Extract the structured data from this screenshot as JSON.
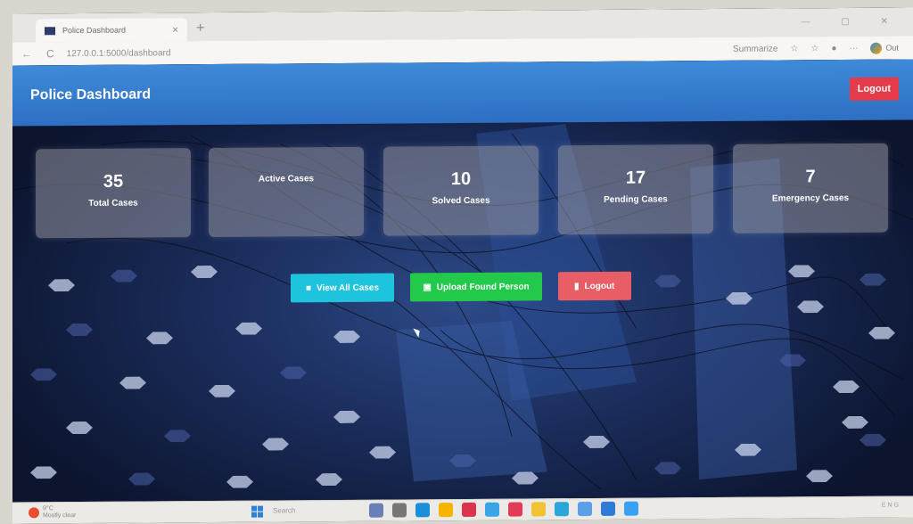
{
  "browser": {
    "tab_title": "Police Dashboard",
    "tab_close": "×",
    "new_tab": "+",
    "window_controls": "—  ▢  ✕",
    "url": "127.0.0.1:5000/dashboard",
    "nav_back": "←",
    "nav_reload": "C",
    "summarize_label": "Summarize",
    "copilot_label": "Out"
  },
  "app": {
    "title": "Police Dashboard",
    "header_logout": "Logout"
  },
  "stats": [
    {
      "value": "35",
      "label": "Total Cases"
    },
    {
      "value": "",
      "label": "Active Cases"
    },
    {
      "value": "10",
      "label": "Solved Cases"
    },
    {
      "value": "17",
      "label": "Pending Cases"
    },
    {
      "value": "7",
      "label": "Emergency Cases"
    }
  ],
  "actions": {
    "view_all": "View All Cases",
    "upload": "Upload Found Person",
    "logout": "Logout"
  },
  "taskbar": {
    "weather_temp": "9°C",
    "weather_text": "Mostly clear",
    "search_placeholder": "Search",
    "tray": "ENG"
  },
  "colors": {
    "header": "#3f8ad9",
    "logout_red": "#e33b4a",
    "view_cyan": "#1ec3de",
    "upload_green": "#22c94a",
    "logout_btn": "#e95d66"
  }
}
